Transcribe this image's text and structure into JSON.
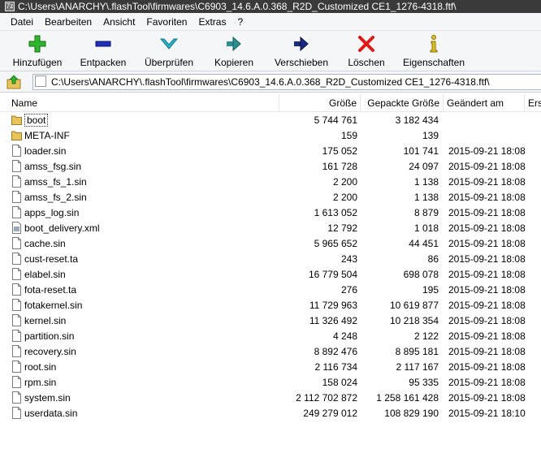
{
  "window": {
    "title": "C:\\Users\\ANARCHY\\.flashTool\\firmwares\\C6903_14.6.A.0.368_R2D_Customized CE1_1276-4318.ftf\\"
  },
  "menu": {
    "items": [
      "Datei",
      "Bearbeiten",
      "Ansicht",
      "Favoriten",
      "Extras",
      "?"
    ]
  },
  "toolbar": {
    "add_label": "Hinzufügen",
    "extract_label": "Entpacken",
    "test_label": "Überprüfen",
    "copy_label": "Kopieren",
    "move_label": "Verschieben",
    "delete_label": "Löschen",
    "info_label": "Eigenschaften"
  },
  "address": {
    "path": "C:\\Users\\ANARCHY\\.flashTool\\firmwares\\C6903_14.6.A.0.368_R2D_Customized CE1_1276-4318.ftf\\"
  },
  "columns": {
    "name": "Name",
    "size": "Größe",
    "packed": "Gepackte Größe",
    "modified": "Geändert am",
    "created": "Ers"
  },
  "files": [
    {
      "name": "boot",
      "type": "folder",
      "size": "5 744 761",
      "packed": "3 182 434",
      "modified": ""
    },
    {
      "name": "META-INF",
      "type": "folder",
      "size": "159",
      "packed": "139",
      "modified": ""
    },
    {
      "name": "loader.sin",
      "type": "file",
      "size": "175 052",
      "packed": "101 741",
      "modified": "2015-09-21 18:08"
    },
    {
      "name": "amss_fsg.sin",
      "type": "file",
      "size": "161 728",
      "packed": "24 097",
      "modified": "2015-09-21 18:08"
    },
    {
      "name": "amss_fs_1.sin",
      "type": "file",
      "size": "2 200",
      "packed": "1 138",
      "modified": "2015-09-21 18:08"
    },
    {
      "name": "amss_fs_2.sin",
      "type": "file",
      "size": "2 200",
      "packed": "1 138",
      "modified": "2015-09-21 18:08"
    },
    {
      "name": "apps_log.sin",
      "type": "file",
      "size": "1 613 052",
      "packed": "8 879",
      "modified": "2015-09-21 18:08"
    },
    {
      "name": "boot_delivery.xml",
      "type": "xml",
      "size": "12 792",
      "packed": "1 018",
      "modified": "2015-09-21 18:08"
    },
    {
      "name": "cache.sin",
      "type": "file",
      "size": "5 965 652",
      "packed": "44 451",
      "modified": "2015-09-21 18:08"
    },
    {
      "name": "cust-reset.ta",
      "type": "file",
      "size": "243",
      "packed": "86",
      "modified": "2015-09-21 18:08"
    },
    {
      "name": "elabel.sin",
      "type": "file",
      "size": "16 779 504",
      "packed": "698 078",
      "modified": "2015-09-21 18:08"
    },
    {
      "name": "fota-reset.ta",
      "type": "file",
      "size": "276",
      "packed": "195",
      "modified": "2015-09-21 18:08"
    },
    {
      "name": "fotakernel.sin",
      "type": "file",
      "size": "11 729 963",
      "packed": "10 619 877",
      "modified": "2015-09-21 18:08"
    },
    {
      "name": "kernel.sin",
      "type": "file",
      "size": "11 326 492",
      "packed": "10 218 354",
      "modified": "2015-09-21 18:08"
    },
    {
      "name": "partition.sin",
      "type": "file",
      "size": "4 248",
      "packed": "2 122",
      "modified": "2015-09-21 18:08"
    },
    {
      "name": "recovery.sin",
      "type": "file",
      "size": "8 892 476",
      "packed": "8 895 181",
      "modified": "2015-09-21 18:08"
    },
    {
      "name": "root.sin",
      "type": "file",
      "size": "2 116 734",
      "packed": "2 117 167",
      "modified": "2015-09-21 18:08"
    },
    {
      "name": "rpm.sin",
      "type": "file",
      "size": "158 024",
      "packed": "95 335",
      "modified": "2015-09-21 18:08"
    },
    {
      "name": "system.sin",
      "type": "file",
      "size": "2 112 702 872",
      "packed": "1 258 161 428",
      "modified": "2015-09-21 18:08"
    },
    {
      "name": "userdata.sin",
      "type": "file",
      "size": "249 279 012",
      "packed": "108 829 190",
      "modified": "2015-09-21 18:10"
    }
  ],
  "colors": {
    "folder": "#e8c25a",
    "add": "#2fb52f",
    "extract": "#1e2fb8",
    "test": "#2ab5c8",
    "copy": "#2a8f8f",
    "move": "#1a2a80",
    "delete": "#e01818",
    "info": "#e0c020"
  },
  "icons": {
    "add": "plus-icon",
    "extract": "minus-icon",
    "test": "check-chevron-icon",
    "copy": "copy-arrow-icon",
    "move": "move-arrow-icon",
    "delete": "x-icon",
    "info": "info-icon",
    "up": "folder-up-icon",
    "folder": "folder-icon",
    "file": "file-icon"
  }
}
